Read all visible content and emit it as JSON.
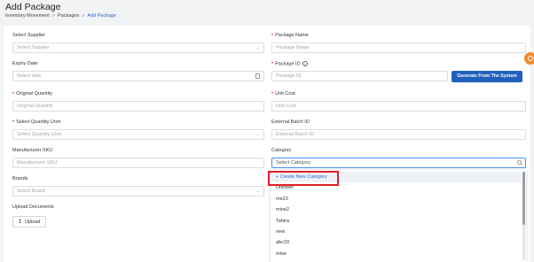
{
  "page": {
    "title": "Add Package",
    "breadcrumb": [
      "Inventory Movement",
      "Packages",
      "Add Package"
    ]
  },
  "form": {
    "select_supplier": {
      "label": "Select Supplier",
      "placeholder": "Select Supplier"
    },
    "package_name": {
      "label": "Package Name",
      "placeholder": "Package Name"
    },
    "expiry_date": {
      "label": "Expiry Date",
      "placeholder": "Select date"
    },
    "package_id": {
      "label": "Package ID",
      "placeholder": "Package ID"
    },
    "generate_button": "Generate From The System",
    "original_quantity": {
      "label": "Original Quantity",
      "placeholder": "Original Quantity"
    },
    "unit_cost": {
      "label": "Unit Cost",
      "placeholder": "Unit Cost"
    },
    "quantity_uom": {
      "label": "Select Quantity Uom",
      "placeholder": "Select Quantity Uom"
    },
    "external_batch_id": {
      "label": "External Batch ID",
      "placeholder": "External Batch ID"
    },
    "manufacturer_sku": {
      "label": "Manufacturer SKU",
      "placeholder": "Manufacturer SKU"
    },
    "category": {
      "label": "Category",
      "placeholder": "Select Category"
    },
    "brands": {
      "label": "Brands",
      "placeholder": "Select Brand"
    },
    "upload_documents": {
      "label": "Upload Documents",
      "button": "Upload"
    }
  },
  "category_dropdown": {
    "create_label": "+ Create New Category",
    "options": [
      "Drllower",
      "me23",
      "mine2",
      "Tahira",
      "new",
      "abc33",
      "mine"
    ]
  },
  "colors": {
    "primary": "#1f5fbd",
    "required": "#e0413c",
    "highlight": "#e21f26",
    "fab": "#f18a2c"
  },
  "icons": {
    "chevron": "chevron-down-icon",
    "calendar": "calendar-icon",
    "search": "search-icon",
    "upload": "upload-icon",
    "info": "info-icon"
  }
}
